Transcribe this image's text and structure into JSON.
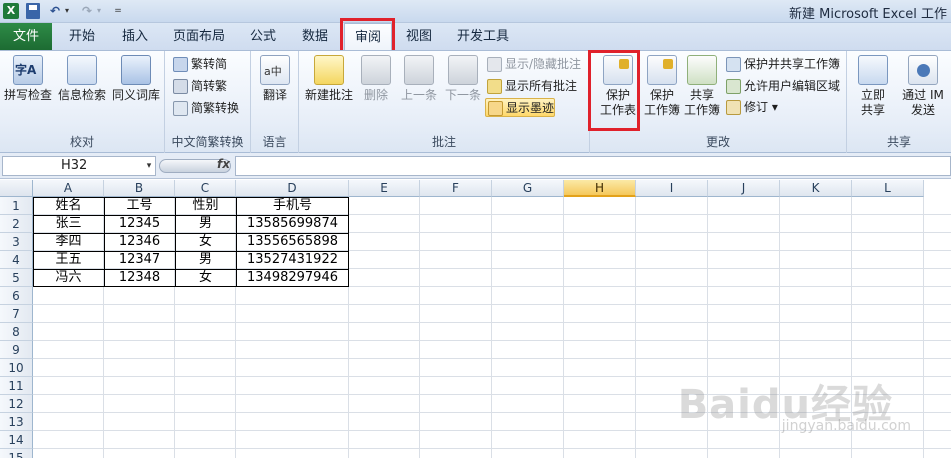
{
  "window": {
    "app_icon": "X",
    "title": "新建 Microsoft Excel 工作"
  },
  "quick_access": {
    "icons": [
      "excel-icon",
      "save-icon",
      "undo-icon",
      "redo-icon",
      "customize-qat-icon"
    ]
  },
  "ribbon_tabs": {
    "file": "文件",
    "home": "开始",
    "insert": "插入",
    "page_layout": "页面布局",
    "formulas": "公式",
    "data": "数据",
    "review": "审阅",
    "view": "视图",
    "developer": "开发工具",
    "active": "审阅"
  },
  "groups": {
    "proofing": {
      "label": "校对",
      "spelling": "拼写检查",
      "research": "信息检索",
      "thesaurus": "同义词库"
    },
    "chinese_conversion": {
      "label": "中文简繁转换",
      "to_traditional": "繁转简",
      "to_simplified": "简转繁",
      "convert": "简繁转换"
    },
    "language": {
      "label": "语言",
      "translate": "翻译"
    },
    "comments": {
      "label": "批注",
      "new_comment": "新建批注",
      "delete": "删除",
      "previous": "上一条",
      "next": "下一条",
      "show_hide": "显示/隐藏批注",
      "show_all": "显示所有批注",
      "show_ink": "显示墨迹"
    },
    "changes": {
      "label": "更改",
      "protect_sheet_line1": "保护",
      "protect_sheet_line2": "工作表",
      "protect_workbook_line1": "保护",
      "protect_workbook_line2": "工作簿",
      "share_workbook_line1": "共享",
      "share_workbook_line2": "工作簿",
      "protect_shared": "保护并共享工作簿",
      "allow_edit_ranges": "允许用户编辑区域",
      "track_changes": "修订",
      "track_changes_drop": "▾"
    },
    "share": {
      "label": "共享",
      "send_now_line1": "立即",
      "send_now_line2": "共享",
      "send_im_line1": "通过 IM",
      "send_im_line2": "发送"
    }
  },
  "formula_bar": {
    "name_box": "H32",
    "name_box_drop": "▾",
    "fx": "fx",
    "formula": ""
  },
  "sheet": {
    "columns": [
      "A",
      "B",
      "C",
      "D",
      "E",
      "F",
      "G",
      "H",
      "I",
      "J",
      "K",
      "L"
    ],
    "selected_column": "H",
    "rows": [
      "1",
      "2",
      "3",
      "4",
      "5",
      "6",
      "7",
      "8",
      "9",
      "10",
      "11",
      "12",
      "13",
      "14",
      "15"
    ],
    "table": [
      [
        "姓名",
        "工号",
        "性别",
        "手机号"
      ],
      [
        "张三",
        "12345",
        "男",
        "13585699874"
      ],
      [
        "李四",
        "12346",
        "女",
        "13556565898"
      ],
      [
        "王五",
        "12347",
        "男",
        "13527431922"
      ],
      [
        "冯六",
        "12348",
        "女",
        "13498297946"
      ]
    ]
  },
  "watermark": {
    "main": "Baidu经验",
    "sub": "jingyan.baidu.com"
  }
}
